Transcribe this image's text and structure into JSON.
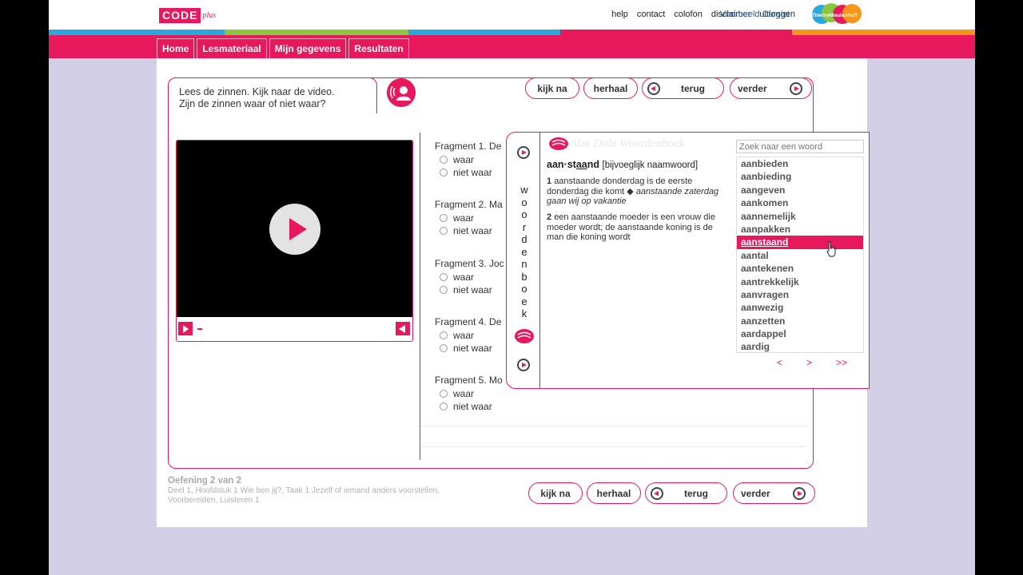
{
  "header": {
    "logo_text": "CODE",
    "logo_suffix": "plus",
    "links": [
      "help",
      "contact",
      "colofon",
      "disclaimer",
      "uitloggen"
    ],
    "user": "Voorbeeld Cursist",
    "publisher_logo": "ThiemeMeulenhoff"
  },
  "nav": [
    "Home",
    "Lesmateriaal",
    "Mijn gegevens",
    "Resultaten"
  ],
  "colors": {
    "accent": "#e8185d",
    "stripe": [
      "#29a8e0",
      "#8cc63f",
      "#e8185d",
      "#f7941d"
    ]
  },
  "exercise": {
    "instruction_line1": "Lees de zinnen. Kijk naar de video.",
    "instruction_line2": "Zijn de zinnen waar of niet waar?",
    "buttons": {
      "check": "kijk na",
      "repeat": "herhaal",
      "back": "terug",
      "next": "verder"
    },
    "fragments": [
      {
        "title": "Fragment 1. De",
        "options": [
          "waar",
          "niet waar"
        ]
      },
      {
        "title": "Fragment 2. Ma",
        "options": [
          "waar",
          "niet waar"
        ]
      },
      {
        "title": "Fragment 3. Joc",
        "options": [
          "waar",
          "niet waar"
        ]
      },
      {
        "title": "Fragment 4. De",
        "options": [
          "waar",
          "niet waar"
        ]
      },
      {
        "title": "Fragment 5. Mo",
        "options": [
          "waar",
          "niet waar"
        ]
      }
    ]
  },
  "dictionary": {
    "brand": "Van Dale Woordenboek",
    "tab_label": "woordenboek",
    "search_placeholder": "Zoek naar een woord",
    "headword_part1": "aan·st",
    "headword_underlined": "aa",
    "headword_part2": "nd",
    "grammar": "[bijvoeglijk naamwoord]",
    "definitions": [
      {
        "num": "1",
        "text": "aanstaande donderdag is de eerste donderdag die komt ◆ ",
        "example": "aanstaande zaterdag gaan wij op vakantie"
      },
      {
        "num": "2",
        "text": "een aanstaande moeder is een vrouw die moeder wordt; de aanstaande koning is de man die koning wordt",
        "example": ""
      }
    ],
    "words": [
      "aanbieden",
      "aanbieding",
      "aangeven",
      "aankomen",
      "aannemelijk",
      "aanpakken",
      "aanstaand",
      "aantal",
      "aantekenen",
      "aantrekkelijk",
      "aanvragen",
      "aanwezig",
      "aanzetten",
      "aardappel",
      "aardig"
    ],
    "selected_word": "aanstaand",
    "pager": [
      "<",
      ">",
      ">>"
    ]
  },
  "footer": {
    "title": "Oefening 2 van 2",
    "path_line1": "Deel 1, Hoofdstuk 1 Wie ben jij?, Taak 1 Jezelf of iemand anders voorstellen,",
    "path_line2": "Voorbereiden, Luisteren 1"
  }
}
